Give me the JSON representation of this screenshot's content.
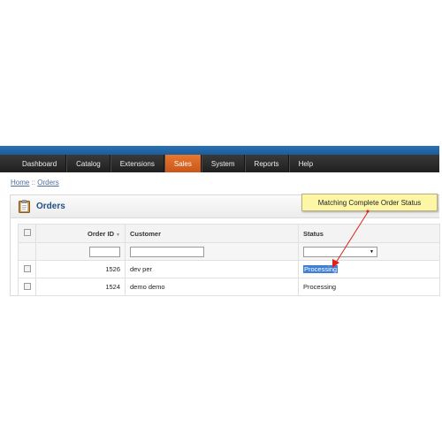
{
  "menu": {
    "items": [
      {
        "label": "Dashboard"
      },
      {
        "label": "Catalog"
      },
      {
        "label": "Extensions"
      },
      {
        "label": "Sales"
      },
      {
        "label": "System"
      },
      {
        "label": "Reports"
      },
      {
        "label": "Help"
      }
    ],
    "active": "Sales",
    "colors": {
      "bar": "#2a2a2a",
      "active": "#dd6a24",
      "strip": "#2367a8"
    }
  },
  "breadcrumb": {
    "home": "Home",
    "separator": "::",
    "current": "Orders"
  },
  "panel": {
    "title": "Orders",
    "icon": "clipboard-icon"
  },
  "table": {
    "columns": {
      "id": "Order ID",
      "customer": "Customer",
      "status": "Status"
    },
    "sort_icon": "sort-desc-icon",
    "rows": [
      {
        "id": "1526",
        "customer": "dev per",
        "status": "Processing"
      },
      {
        "id": "1524",
        "customer": "demo demo",
        "status": "Processing"
      }
    ]
  },
  "tooltip": {
    "text": "Matching Complete Order Status",
    "color": "#fdf6a7",
    "arrow_color": "#e0201a"
  }
}
